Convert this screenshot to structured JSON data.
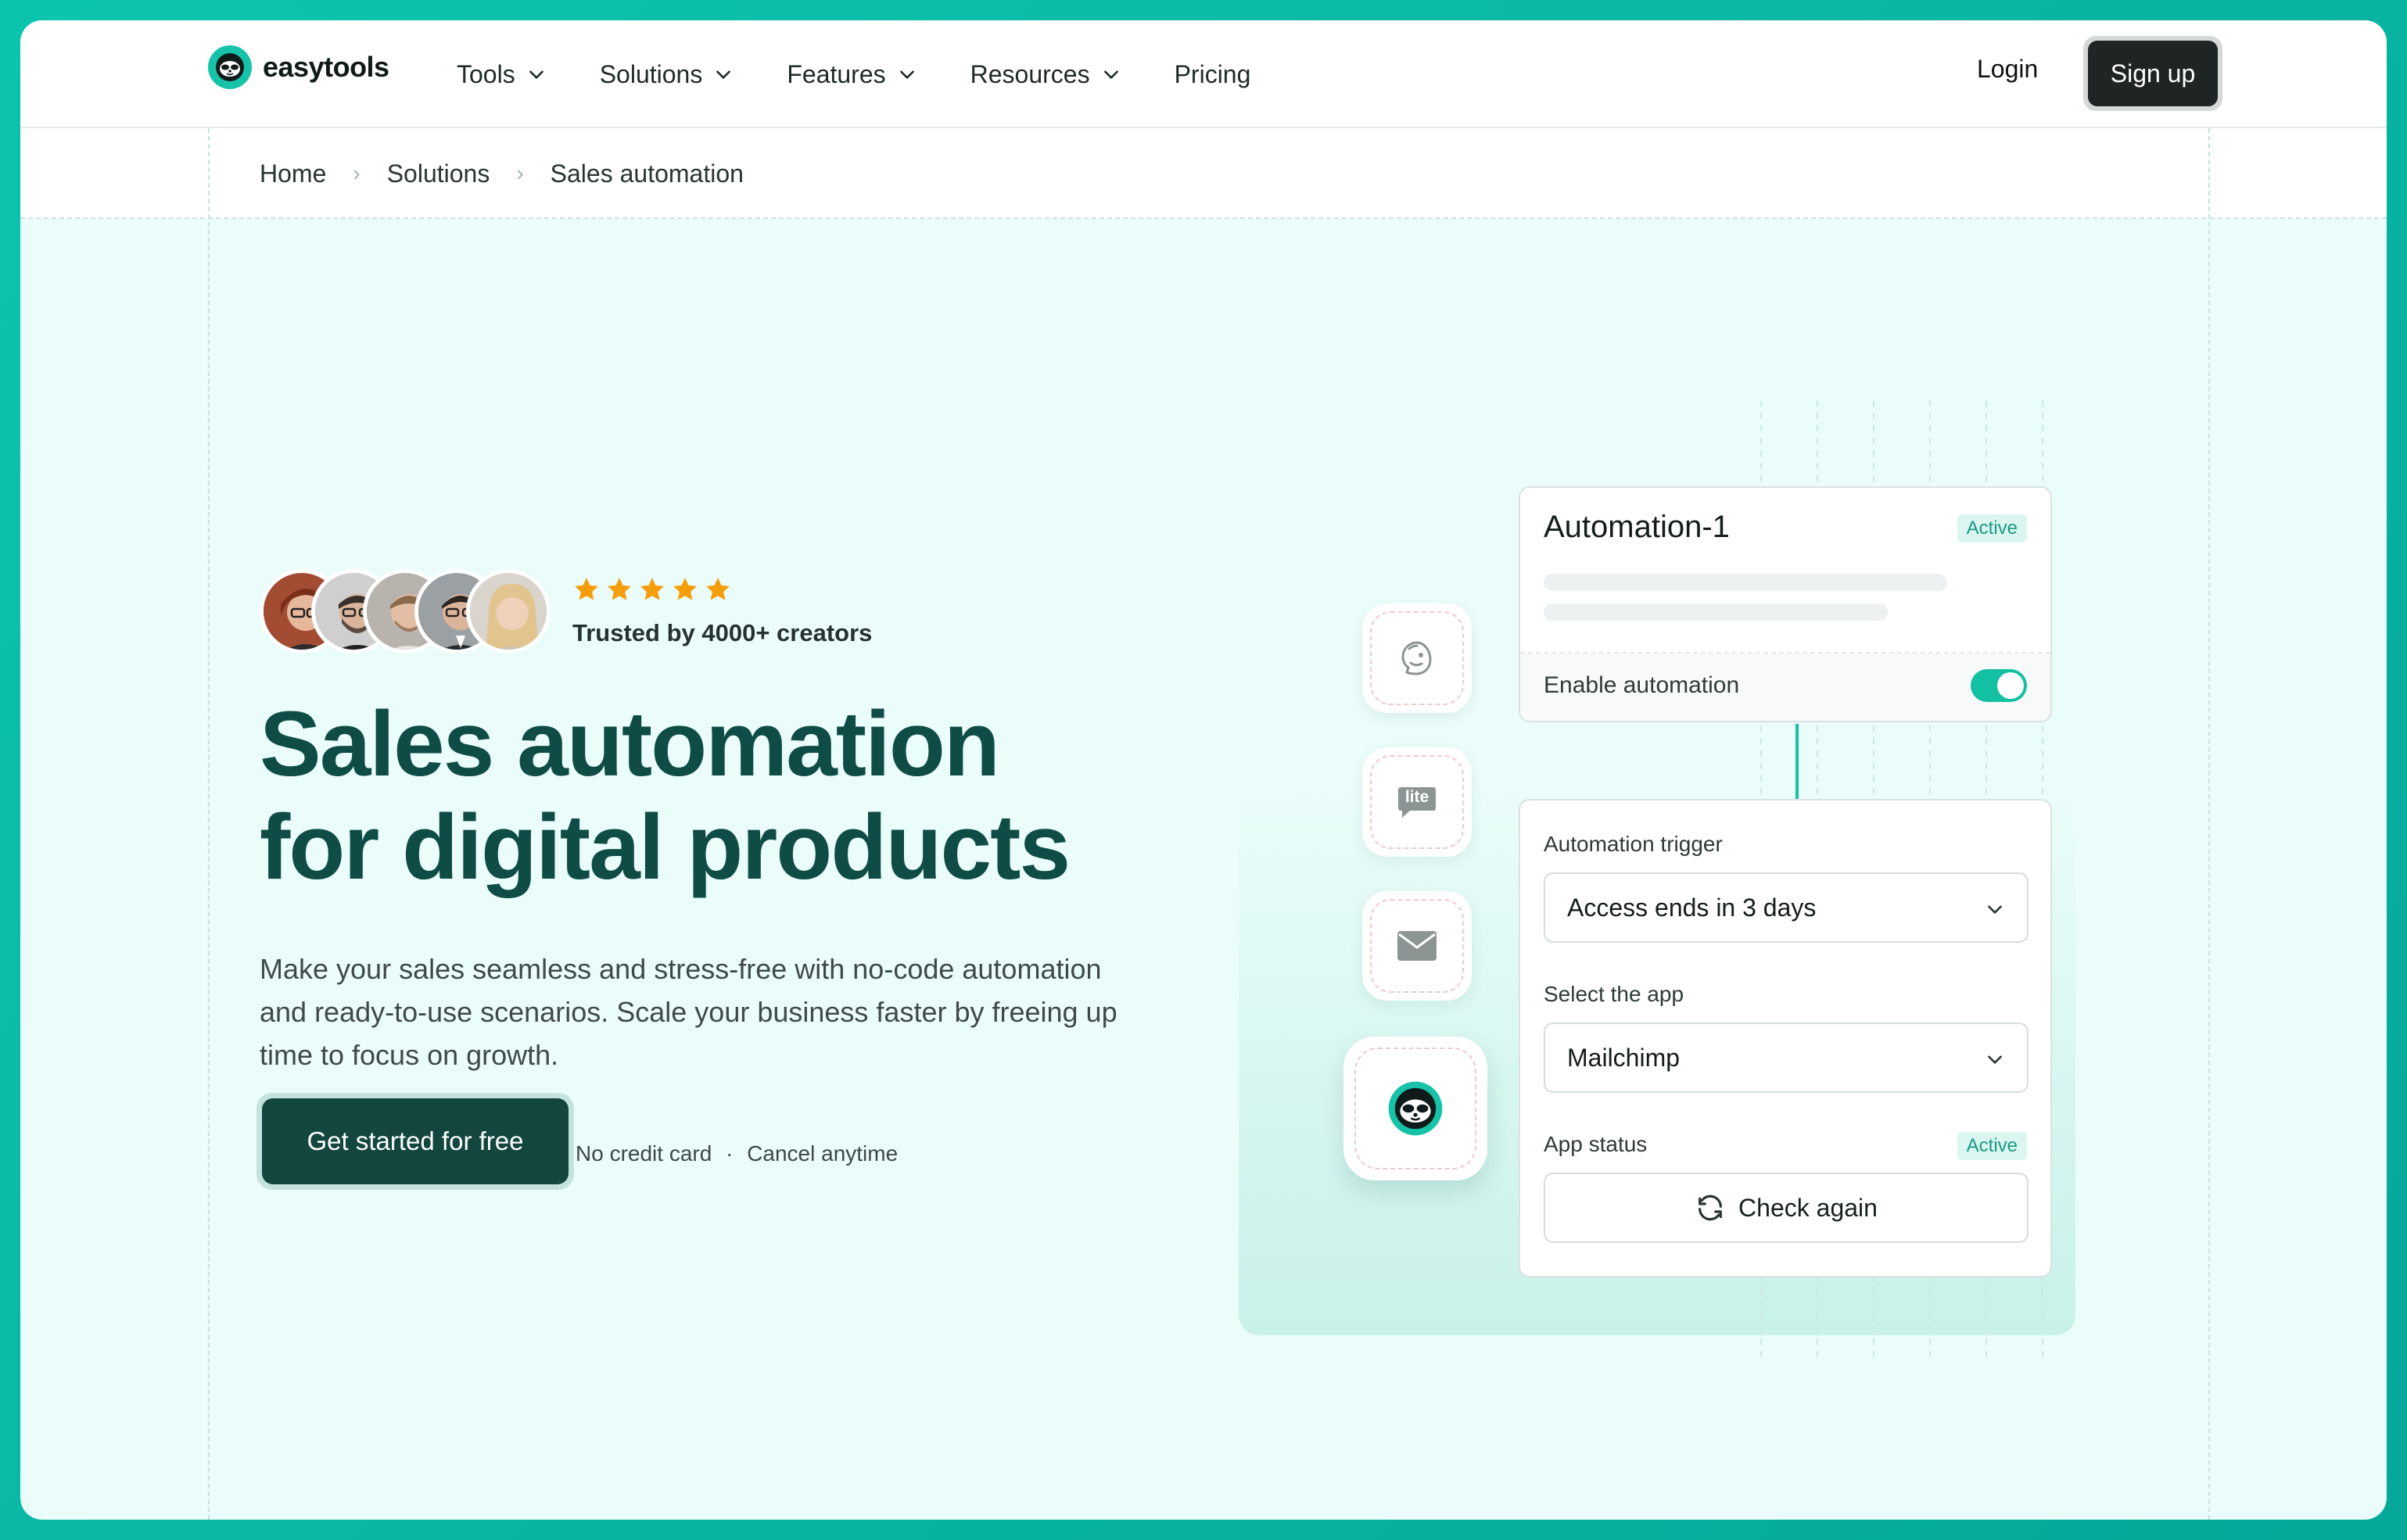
{
  "brand": {
    "name": "easytools"
  },
  "nav": {
    "items": [
      {
        "label": "Tools",
        "dropdown": true
      },
      {
        "label": "Solutions",
        "dropdown": true
      },
      {
        "label": "Features",
        "dropdown": true
      },
      {
        "label": "Resources",
        "dropdown": true
      },
      {
        "label": "Pricing",
        "dropdown": false
      }
    ],
    "login": "Login",
    "signup": "Sign up"
  },
  "breadcrumb": [
    "Home",
    "Solutions",
    "Sales automation"
  ],
  "hero": {
    "rating": 5,
    "trusted": "Trusted by 4000+ creators",
    "headline_line1": "Sales automation",
    "headline_line2": "for digital products",
    "subtext": "Make your sales seamless and stress-free with no-code automation and ready-to-use scenarios. Scale your business faster by freeing up time to focus on growth.",
    "cta": "Get started for free",
    "cta_note_1": "No credit card",
    "cta_note_sep": "·",
    "cta_note_2": "Cancel anytime"
  },
  "illustration": {
    "apps": [
      "mailchimp-icon",
      "mailerlite-icon",
      "email-icon",
      "easytools-icon"
    ],
    "mailerlite_text": "lite",
    "automation": {
      "title": "Automation-1",
      "status": "Active",
      "enable_label": "Enable automation",
      "enabled": true
    },
    "config": {
      "trigger_label": "Automation trigger",
      "trigger_value": "Access ends in 3 days",
      "app_label": "Select the app",
      "app_value": "Mailchimp",
      "status_label": "App status",
      "status_value": "Active",
      "check_button": "Check again"
    }
  },
  "colors": {
    "accent": "#17c3a8",
    "headline": "#0f4c46",
    "cta": "#12463f",
    "star": "#f59e0b"
  }
}
